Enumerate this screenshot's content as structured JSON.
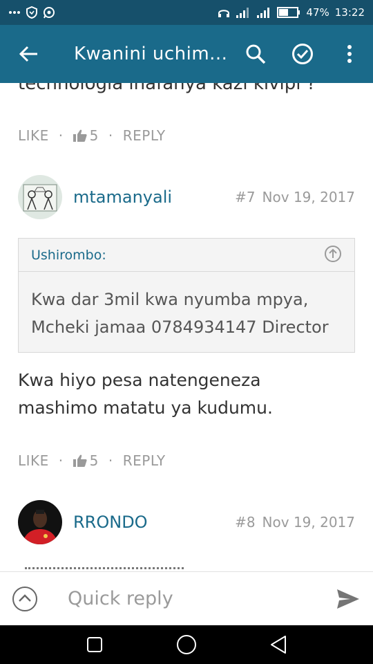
{
  "status_bar": {
    "battery": "47%",
    "time": "13:22",
    "left_icons": [
      "more-dots-icon",
      "shield-icon",
      "whatsapp-icon"
    ],
    "right_icons": [
      "headphones-icon",
      "signal-icon",
      "signal-icon",
      "battery-icon"
    ]
  },
  "app_bar": {
    "title": "Kwanini uchim...",
    "icons": [
      "back-arrow-icon",
      "search-icon",
      "check-circle-icon",
      "overflow-menu-icon"
    ]
  },
  "partial_text": "technologia inafanya kazi kivipi ?",
  "posts": [
    {
      "actions": {
        "like": "LIKE",
        "likes": "5",
        "reply": "REPLY"
      }
    },
    {
      "username": "mtamanyali",
      "number": "#7",
      "date": "Nov 19, 2017",
      "quote": {
        "author": "Ushirombo:",
        "lines": [
          "Kwa dar 3mil kwa nyumba mpya,",
          "Mcheki jamaa 0784934147 Director"
        ]
      },
      "text_lines": [
        "Kwa hiyo pesa natengeneza",
        "mashimo matatu ya kudumu."
      ],
      "actions": {
        "like": "LIKE",
        "likes": "5",
        "reply": "REPLY"
      }
    },
    {
      "username": "RRONDO",
      "number": "#8",
      "date": "Nov 19, 2017"
    }
  ],
  "quick_reply": {
    "placeholder": "Quick reply"
  },
  "nav_bar": {
    "icons": [
      "recents-square-icon",
      "home-circle-icon",
      "back-triangle-icon"
    ]
  },
  "colors": {
    "status_bar": "#16506b",
    "app_bar": "#1a6a8a",
    "link": "#1a6a8a",
    "muted": "#9a9a9a"
  }
}
